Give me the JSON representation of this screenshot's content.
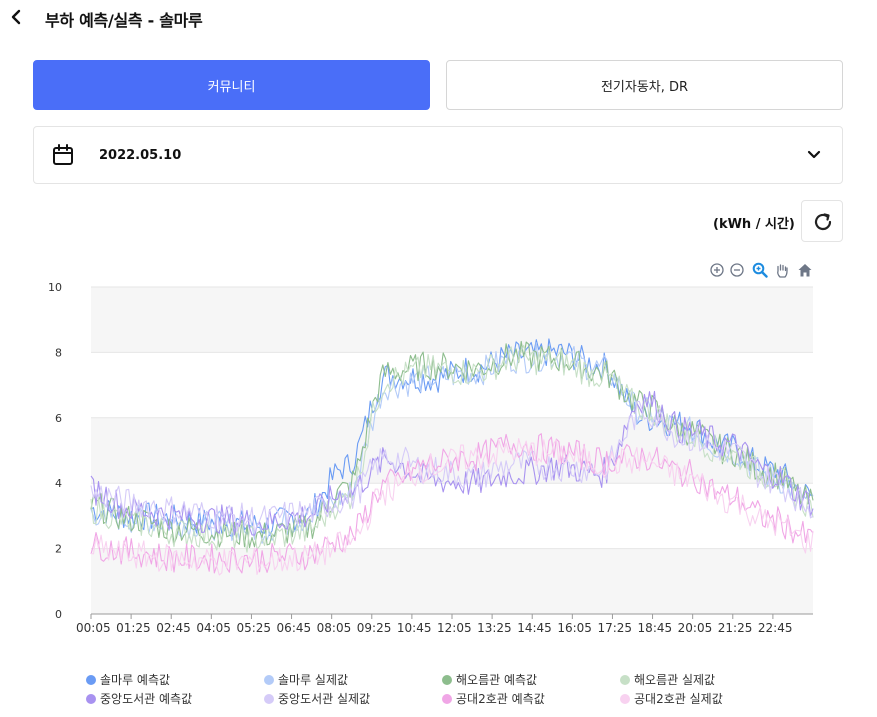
{
  "header": {
    "title": "부하 예측/실측 - 솔마루"
  },
  "tabs": [
    {
      "label": "커뮤니티",
      "active": true
    },
    {
      "label": "전기자동차, DR",
      "active": false
    }
  ],
  "date_picker": {
    "value": "2022.05.10"
  },
  "unit": "(kWh / 시간)",
  "toolbox": [
    "zoom-in-icon",
    "zoom-out-icon",
    "zoom-select-icon",
    "pan-icon",
    "reset-home-icon"
  ],
  "colors": {
    "accent": "#4a6ef8"
  },
  "chart_data": {
    "type": "line",
    "x": [
      "00:05",
      "01:25",
      "02:45",
      "04:05",
      "05:25",
      "06:45",
      "08:05",
      "09:25",
      "10:45",
      "12:05",
      "13:25",
      "14:45",
      "16:05",
      "17:25",
      "18:45",
      "20:05",
      "21:25",
      "22:45"
    ],
    "ylim": [
      0,
      10
    ],
    "yticks": [
      0,
      2,
      4,
      6,
      8,
      10
    ],
    "grid": true,
    "legend_position": "bottom",
    "series": [
      {
        "name": "솔마루 예측값",
        "color": "#6a9bf4",
        "values": [
          3.2,
          3.0,
          2.9,
          2.8,
          2.7,
          3.0,
          4.5,
          7.3,
          7.2,
          7.5,
          7.9,
          8.0,
          7.6,
          6.0,
          5.8,
          5.1,
          4.4,
          3.6
        ]
      },
      {
        "name": "솔마루 실제값",
        "color": "#b3cbf8",
        "values": [
          3.1,
          2.9,
          2.8,
          2.7,
          2.6,
          2.9,
          3.6,
          7.0,
          7.2,
          7.4,
          7.8,
          7.9,
          7.5,
          6.2,
          5.6,
          5.0,
          4.2,
          3.4
        ]
      },
      {
        "name": "해오름관 예측값",
        "color": "#8dbd8d",
        "values": [
          3.3,
          2.9,
          2.6,
          2.5,
          2.4,
          2.6,
          3.8,
          7.4,
          7.6,
          7.5,
          7.9,
          7.8,
          7.4,
          6.4,
          5.6,
          5.0,
          4.3,
          3.4
        ]
      },
      {
        "name": "해오름관 실제값",
        "color": "#c7e0c7",
        "values": [
          3.2,
          2.8,
          2.5,
          2.4,
          2.3,
          2.5,
          3.5,
          7.2,
          7.5,
          7.4,
          7.8,
          7.7,
          7.3,
          6.3,
          5.5,
          4.9,
          4.2,
          3.3
        ]
      },
      {
        "name": "중앙도서관 예측값",
        "color": "#a892f0",
        "values": [
          3.8,
          3.2,
          3.0,
          2.9,
          2.8,
          3.0,
          3.7,
          4.7,
          4.1,
          4.0,
          4.3,
          4.5,
          4.3,
          6.6,
          5.6,
          5.2,
          4.3,
          3.4
        ]
      },
      {
        "name": "중앙도서관 실제값",
        "color": "#d5cbf8",
        "values": [
          3.7,
          3.4,
          3.2,
          3.0,
          2.9,
          3.1,
          3.5,
          4.8,
          4.4,
          4.2,
          4.6,
          4.5,
          4.4,
          6.2,
          5.4,
          5.0,
          4.1,
          3.3
        ]
      },
      {
        "name": "공대2호관 예측값",
        "color": "#f0a6e6",
        "values": [
          2.1,
          1.9,
          1.7,
          1.7,
          1.7,
          1.8,
          2.3,
          4.0,
          4.6,
          4.8,
          5.2,
          5.0,
          4.7,
          4.8,
          4.3,
          3.6,
          2.9,
          2.3
        ]
      },
      {
        "name": "공대2호관 실제값",
        "color": "#f8d2f0",
        "values": [
          2.0,
          1.8,
          1.7,
          1.6,
          1.6,
          1.7,
          2.1,
          3.8,
          4.5,
          4.8,
          5.0,
          4.9,
          4.6,
          4.7,
          4.2,
          3.5,
          2.8,
          2.2
        ]
      }
    ]
  }
}
